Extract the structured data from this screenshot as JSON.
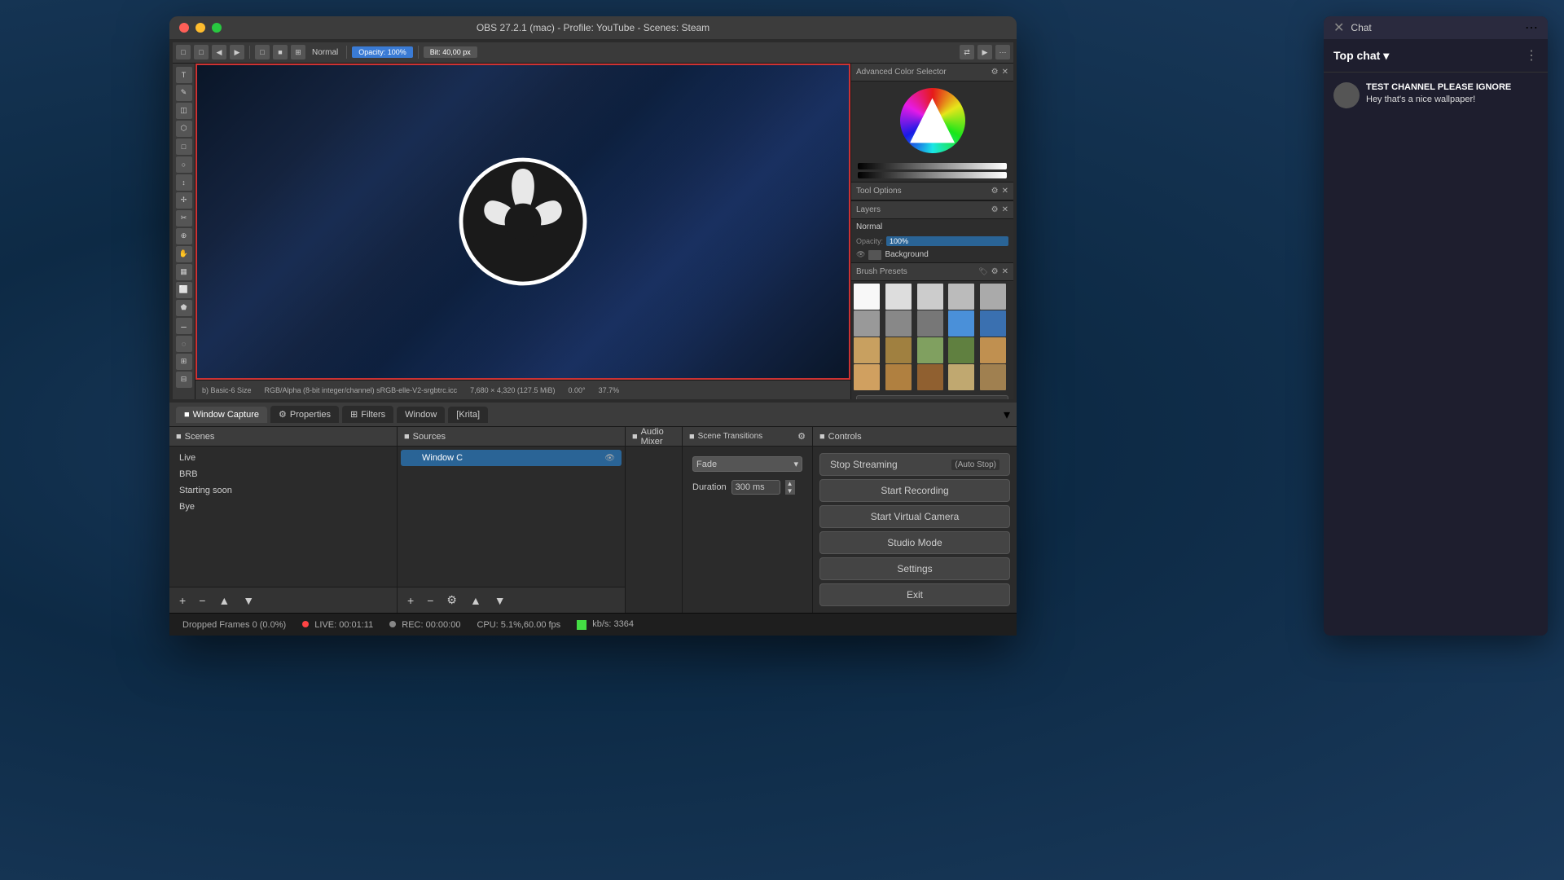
{
  "window": {
    "title": "OBS 27.2.1 (mac) - Profile: YouTube - Scenes: Steam",
    "traffic_lights": [
      "close",
      "minimize",
      "maximize"
    ]
  },
  "krita": {
    "toolbar_items": [
      "←",
      "→",
      "↺",
      "↻",
      "□",
      "■",
      "⊞",
      "N",
      "Opacity: 100%",
      "Bit: 40,00 px"
    ],
    "tool_icons": [
      "T",
      "✎",
      "⬡",
      "⬢",
      "□",
      "⬜",
      "↕",
      "↔",
      "⤡",
      "✂",
      "⬟",
      "◈",
      "⊕",
      "⊗",
      "⊞",
      "⊟",
      "◐",
      "◑"
    ],
    "color_wheel_label": "Advanced Color Selector",
    "layers_label": "Layers",
    "blend_mode": "Normal",
    "opacity": "100%",
    "layer_name": "Background",
    "brush_presets_label": "Brush Presets",
    "status": {
      "layer": "b) Basic-6 Size",
      "color_space": "RGB/Alpha (8-bit integer/channel) sRGB-elle-V2-srgbtrc.icc",
      "size": "7,680 × 4,320 (127.5 MiB)",
      "angle": "0.00°",
      "zoom": "37.7%"
    },
    "file_name": "OBS Wallpaper.png"
  },
  "obs": {
    "tabs": [
      {
        "label": "Window Capture",
        "icon": "■"
      },
      {
        "label": "Properties",
        "icon": "⚙"
      },
      {
        "label": "Filters",
        "icon": "⊞"
      },
      {
        "label": "Window",
        "icon": ""
      },
      {
        "label": "[Krita]",
        "icon": ""
      }
    ],
    "scenes_panel": {
      "label": "Scenes",
      "items": [
        "Live",
        "BRB",
        "Starting soon",
        "Bye"
      ]
    },
    "sources_panel": {
      "label": "Sources",
      "items": [
        {
          "name": "Window C",
          "selected": true
        }
      ]
    },
    "audio_panel": {
      "label": "Audio Mixer"
    },
    "transitions_panel": {
      "label": "Scene Transitions",
      "type": "Fade",
      "duration_label": "Duration",
      "duration_value": "300 ms"
    },
    "controls_panel": {
      "label": "Controls",
      "buttons": [
        {
          "id": "stop-streaming",
          "label": "Stop Streaming",
          "badge": "(Auto Stop)"
        },
        {
          "id": "start-recording",
          "label": "Start Recording"
        },
        {
          "id": "start-virtual-camera",
          "label": "Start Virtual Camera"
        },
        {
          "id": "studio-mode",
          "label": "Studio Mode"
        },
        {
          "id": "settings",
          "label": "Settings"
        },
        {
          "id": "exit",
          "label": "Exit"
        }
      ]
    },
    "status_bar": {
      "dropped_frames": "Dropped Frames 0 (0.0%)",
      "live_label": "LIVE:",
      "live_time": "00:01:11",
      "rec_label": "REC:",
      "rec_time": "00:00:00",
      "cpu": "CPU: 5.1%,60.00 fps",
      "kbps_label": "kb/s:",
      "kbps_value": "3364"
    }
  },
  "chat": {
    "title": "Chat",
    "selector": "Top chat",
    "messages": [
      {
        "username": "TEST CHANNEL PLEASE IGNORE",
        "text": "Hey that's a nice wallpaper!"
      }
    ]
  }
}
